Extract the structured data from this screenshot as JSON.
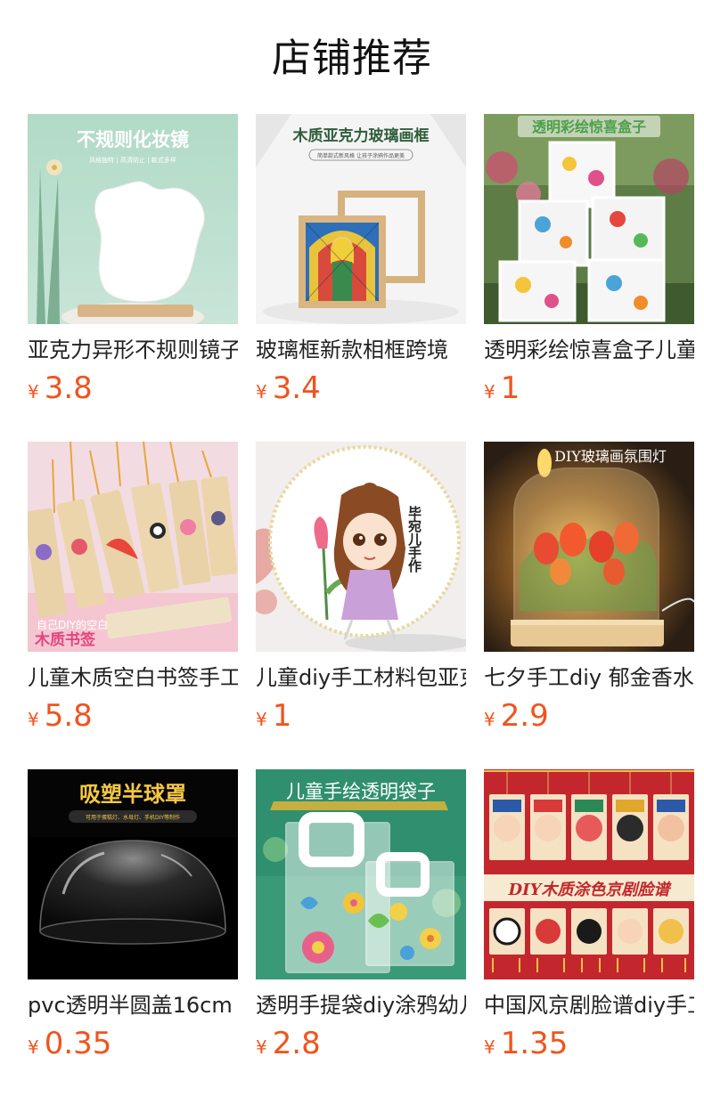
{
  "header": {
    "title": "店铺推荐"
  },
  "currency_symbol": "¥",
  "products": [
    {
      "title": "亚克力异形不规则镜子",
      "price": "3.8",
      "image_text": "不规则化妆镜",
      "image_subtext": "风格独特 | 高清防止 | 款式多样",
      "image_icon": "irregular-mirror-icon"
    },
    {
      "title": "玻璃框新款相框跨境",
      "price": "3.4",
      "image_text": "木质亚克力玻璃画框",
      "image_subtext": "简单款式新风格 让孩子涂鸦作品更美",
      "image_icon": "glass-frame-icon"
    },
    {
      "title": "透明彩绘惊喜盒子儿童",
      "price": "1",
      "image_text": "透明彩绘惊喜盒子",
      "image_subtext": "",
      "image_icon": "surprise-box-icon"
    },
    {
      "title": "儿童木质空白书签手工",
      "price": "5.8",
      "image_text": "木质书签",
      "image_subtext": "自己DIY的空白",
      "image_icon": "bookmark-icon"
    },
    {
      "title": "儿童diy手工材料包亚克力",
      "price": "1",
      "image_text": "毕宛儿手作",
      "image_subtext": "",
      "image_icon": "painted-plate-icon"
    },
    {
      "title": "七夕手工diy 郁金香水晶",
      "price": "2.9",
      "image_text": "DIY玻璃画氛围灯",
      "image_subtext": "",
      "image_icon": "tulip-lamp-icon"
    },
    {
      "title": "pvc透明半圆盖16cm",
      "price": "0.35",
      "image_text": "吸塑半球罩",
      "image_subtext": "可用于蛋糕灯、水母灯、手机DIY等制作",
      "image_icon": "dome-cover-icon"
    },
    {
      "title": "透明手提袋diy涂鸦幼儿园",
      "price": "2.8",
      "image_text": "儿童手绘透明袋子",
      "image_subtext": "",
      "image_icon": "tote-bag-icon"
    },
    {
      "title": "中国风京剧脸谱diy手工",
      "price": "1.35",
      "image_text": "DIY木质涂色京剧脸谱",
      "image_subtext": "",
      "image_icon": "opera-mask-icon"
    }
  ],
  "colors": {
    "price": "#f0541e",
    "title": "#222222"
  }
}
